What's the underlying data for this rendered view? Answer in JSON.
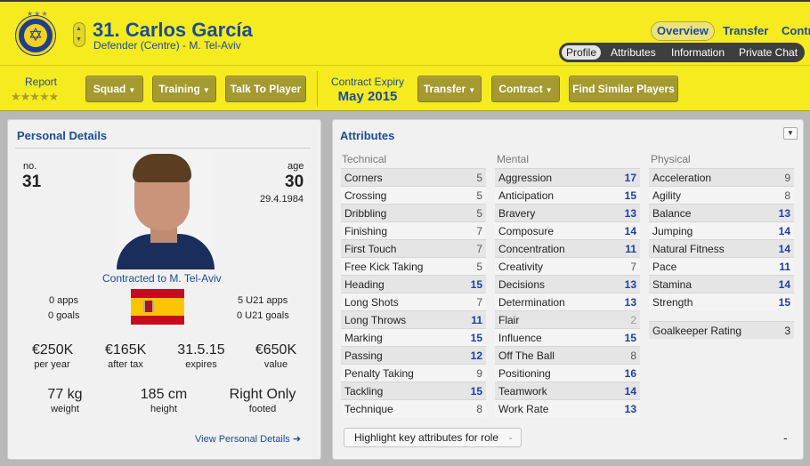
{
  "header": {
    "player_name": "31. Carlos García",
    "player_role": "Defender (Centre) - M. Tel-Aviv",
    "club_crest_stars": "★★★",
    "tabs": [
      "Overview",
      "Transfer",
      "Contr"
    ],
    "subtabs": [
      "Profile",
      "Attributes",
      "Information",
      "Private Chat"
    ],
    "accent_color": "#f6eb1e",
    "title_color": "#1c4c96"
  },
  "toolbar": {
    "report_label": "Report",
    "report_stars": "★★★★★",
    "squad": "Squad",
    "training": "Training",
    "talk": "Talk To Player",
    "contract_expiry_label": "Contract Expiry",
    "contract_expiry_value": "May 2015",
    "transfer": "Transfer",
    "contract": "Contract",
    "similar": "Find Similar Players"
  },
  "personal": {
    "title": "Personal Details",
    "no_label": "no.",
    "no_value": "31",
    "age_label": "age",
    "age_value": "30",
    "dob": "29.4.1984",
    "contracted": "Contracted to M. Tel-Aviv",
    "apps": "0 apps",
    "goals": "0 goals",
    "u21_apps": "5 U21 apps",
    "u21_goals": "0 U21 goals",
    "wage_value": "€250K",
    "wage_label": "per year",
    "aftertax_value": "€165K",
    "aftertax_label": "after tax",
    "expires_value": "31.5.15",
    "expires_label": "expires",
    "value_value": "€650K",
    "value_label": "value",
    "weight_value": "77 kg",
    "weight_label": "weight",
    "height_value": "185 cm",
    "height_label": "height",
    "foot_value": "Right Only",
    "foot_label": "footed",
    "view_link": "View Personal Details ➜"
  },
  "attributes": {
    "title": "Attributes",
    "technical_title": "Technical",
    "mental_title": "Mental",
    "physical_title": "Physical",
    "technical": [
      {
        "name": "Corners",
        "value": "5"
      },
      {
        "name": "Crossing",
        "value": "5"
      },
      {
        "name": "Dribbling",
        "value": "5"
      },
      {
        "name": "Finishing",
        "value": "7"
      },
      {
        "name": "First Touch",
        "value": "7"
      },
      {
        "name": "Free Kick Taking",
        "value": "5"
      },
      {
        "name": "Heading",
        "value": "15"
      },
      {
        "name": "Long Shots",
        "value": "7"
      },
      {
        "name": "Long Throws",
        "value": "11"
      },
      {
        "name": "Marking",
        "value": "15"
      },
      {
        "name": "Passing",
        "value": "12"
      },
      {
        "name": "Penalty Taking",
        "value": "9"
      },
      {
        "name": "Tackling",
        "value": "15"
      },
      {
        "name": "Technique",
        "value": "8"
      }
    ],
    "mental": [
      {
        "name": "Aggression",
        "value": "17"
      },
      {
        "name": "Anticipation",
        "value": "15"
      },
      {
        "name": "Bravery",
        "value": "13"
      },
      {
        "name": "Composure",
        "value": "14"
      },
      {
        "name": "Concentration",
        "value": "11"
      },
      {
        "name": "Creativity",
        "value": "7"
      },
      {
        "name": "Decisions",
        "value": "13"
      },
      {
        "name": "Determination",
        "value": "13"
      },
      {
        "name": "Flair",
        "value": "2"
      },
      {
        "name": "Influence",
        "value": "15"
      },
      {
        "name": "Off The Ball",
        "value": "8"
      },
      {
        "name": "Positioning",
        "value": "16"
      },
      {
        "name": "Teamwork",
        "value": "14"
      },
      {
        "name": "Work Rate",
        "value": "13"
      }
    ],
    "physical": [
      {
        "name": "Acceleration",
        "value": "9"
      },
      {
        "name": "Agility",
        "value": "8"
      },
      {
        "name": "Balance",
        "value": "13"
      },
      {
        "name": "Jumping",
        "value": "14"
      },
      {
        "name": "Natural Fitness",
        "value": "14"
      },
      {
        "name": "Pace",
        "value": "11"
      },
      {
        "name": "Stamina",
        "value": "14"
      },
      {
        "name": "Strength",
        "value": "15"
      }
    ],
    "gk_rating_label": "Goalkeeper Rating",
    "gk_rating_value": "3",
    "highlight": "Highlight key attributes for role",
    "minus": "-"
  }
}
